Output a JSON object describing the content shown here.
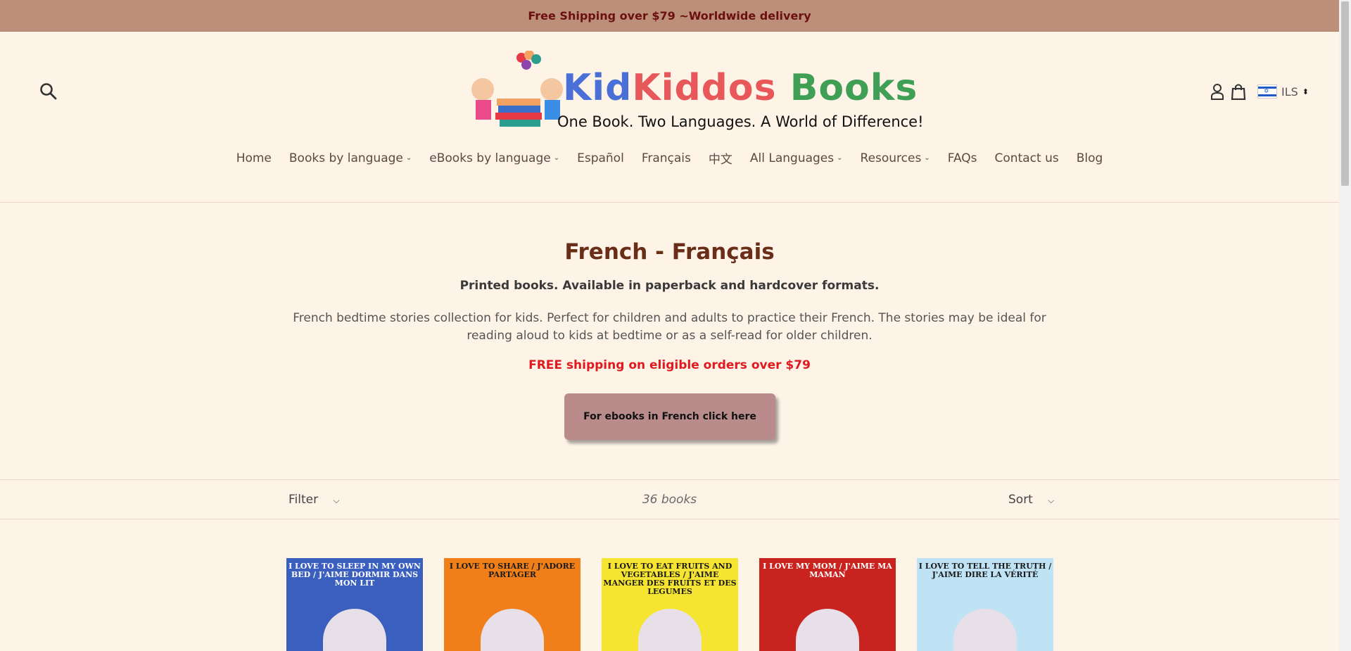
{
  "announcement": "Free Shipping over $79 ~Worldwide delivery",
  "logo": {
    "brand": "KidKiddos Books",
    "tagline": "One Book. Two Languages. A World of Difference!"
  },
  "currency": {
    "code": "ILS"
  },
  "nav": [
    {
      "label": "Home",
      "dropdown": false
    },
    {
      "label": "Books by language",
      "dropdown": true
    },
    {
      "label": "eBooks by language",
      "dropdown": true
    },
    {
      "label": "Español",
      "dropdown": false
    },
    {
      "label": "Français",
      "dropdown": false
    },
    {
      "label": "中文",
      "dropdown": false
    },
    {
      "label": "All Languages",
      "dropdown": true
    },
    {
      "label": "Resources",
      "dropdown": true
    },
    {
      "label": "FAQs",
      "dropdown": false
    },
    {
      "label": "Contact us",
      "dropdown": false
    },
    {
      "label": "Blog",
      "dropdown": false
    }
  ],
  "collection": {
    "title": "French - Français",
    "subtitle": "Printed books. Available in paperback and hardcover formats.",
    "description": "French bedtime stories collection for kids. Perfect for children and adults to practice their French. The stories may be ideal for reading aloud to kids at bedtime or as a self-read for older children.",
    "shipping_note": "FREE shipping on eligible orders over $79",
    "ebook_button": "For ebooks in French click here"
  },
  "toolbar": {
    "filter": "Filter",
    "count": "36 books",
    "sort": "Sort"
  },
  "books": [
    {
      "title": "I LOVE TO SLEEP IN MY OWN BED / J'AIME DORMIR DANS MON LIT",
      "cover_color": "#3b5fbf",
      "text_color": "#ffffff"
    },
    {
      "title": "I LOVE TO SHARE / J'ADORE PARTAGER",
      "cover_color": "#f07f1a",
      "text_color": "#1a1a1a"
    },
    {
      "title": "I LOVE TO EAT FRUITS AND VEGETABLES / J'AIME MANGER DES FRUITS ET DES LEGUMES",
      "cover_color": "#f6e432",
      "text_color": "#1a1a1a"
    },
    {
      "title": "I LOVE MY MOM / J'AIME MA MAMAN",
      "cover_color": "#c8231f",
      "text_color": "#ffffff"
    },
    {
      "title": "I LOVE TO TELL THE TRUTH / J'AIME DIRE LA VÉRITÉ",
      "cover_color": "#bfe3f5",
      "text_color": "#1a1a1a"
    }
  ]
}
